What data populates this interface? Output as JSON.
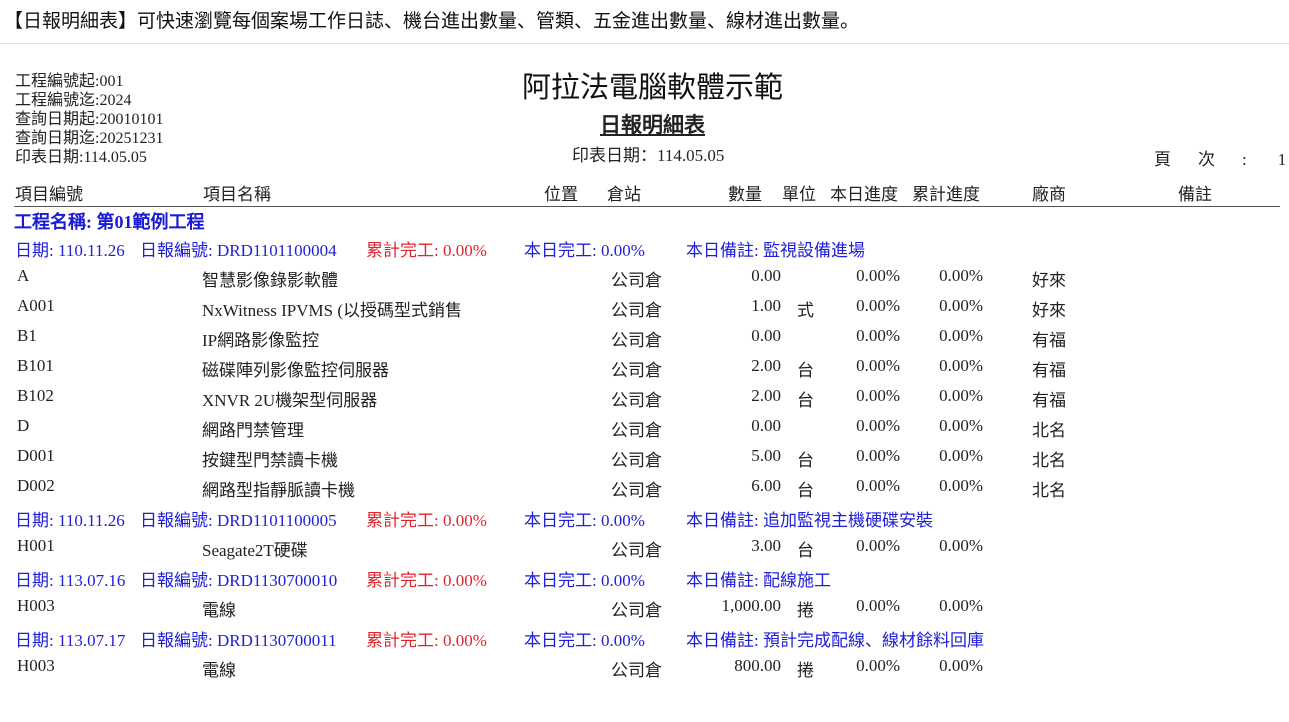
{
  "banner": "【日報明細表】可快速瀏覽每個案場工作日誌、機台進出數量、管類、五金進出數量、線材進出數量。",
  "meta": [
    "工程編號起:001",
    "工程編號迄:2024",
    "查詢日期起:20010101",
    "查詢日期迄:20251231",
    "印表日期:114.05.05"
  ],
  "company": "阿拉法電腦軟體示範",
  "report_title": "日報明細表",
  "print_date": "印表日期：114.05.05",
  "page": {
    "label": "頁次:",
    "number": "1"
  },
  "columns": {
    "code": "項目編號",
    "name": "項目名稱",
    "location": "位置",
    "warehouse": "倉站",
    "qty": "數量",
    "unit": "單位",
    "today": "本日進度",
    "cumulative": "累計進度",
    "vendor": "廠商",
    "note": "備註"
  },
  "project": "工程名稱: 第01範例工程",
  "groups": [
    {
      "date": "日期: 110.11.26",
      "report": "日報編號: DRD1101100004",
      "cum": "累計完工:  0.00%",
      "today": "本日完工:  0.00%",
      "note": "本日備註: 監視設備進場",
      "items": [
        {
          "code": "A",
          "name": "智慧影像錄影軟體",
          "warehouse": "公司倉",
          "qty": "0.00",
          "unit": "",
          "today": "0.00%",
          "cum": "0.00%",
          "vendor": "好來"
        },
        {
          "code": "A001",
          "name": "NxWitness IPVMS (以授碼型式銷售",
          "warehouse": "公司倉",
          "qty": "1.00",
          "unit": "式",
          "today": "0.00%",
          "cum": "0.00%",
          "vendor": "好來"
        },
        {
          "code": "B1",
          "name": "IP網路影像監控",
          "warehouse": "公司倉",
          "qty": "0.00",
          "unit": "",
          "today": "0.00%",
          "cum": "0.00%",
          "vendor": "有福"
        },
        {
          "code": "B101",
          "name": "磁碟陣列影像監控伺服器",
          "warehouse": "公司倉",
          "qty": "2.00",
          "unit": "台",
          "today": "0.00%",
          "cum": "0.00%",
          "vendor": "有福"
        },
        {
          "code": "B102",
          "name": "XNVR 2U機架型伺服器",
          "warehouse": "公司倉",
          "qty": "2.00",
          "unit": "台",
          "today": "0.00%",
          "cum": "0.00%",
          "vendor": "有福"
        },
        {
          "code": "D",
          "name": "網路門禁管理",
          "warehouse": "公司倉",
          "qty": "0.00",
          "unit": "",
          "today": "0.00%",
          "cum": "0.00%",
          "vendor": "北名"
        },
        {
          "code": "D001",
          "name": "按鍵型門禁讀卡機",
          "warehouse": "公司倉",
          "qty": "5.00",
          "unit": "台",
          "today": "0.00%",
          "cum": "0.00%",
          "vendor": "北名"
        },
        {
          "code": "D002",
          "name": "網路型指靜脈讀卡機",
          "warehouse": "公司倉",
          "qty": "6.00",
          "unit": "台",
          "today": "0.00%",
          "cum": "0.00%",
          "vendor": "北名"
        }
      ]
    },
    {
      "date": "日期: 110.11.26",
      "report": "日報編號: DRD1101100005",
      "cum": "累計完工:  0.00%",
      "today": "本日完工:  0.00%",
      "note": "本日備註: 追加監視主機硬碟安裝",
      "items": [
        {
          "code": "H001",
          "name": "Seagate2T硬碟",
          "warehouse": "公司倉",
          "qty": "3.00",
          "unit": "台",
          "today": "0.00%",
          "cum": "0.00%",
          "vendor": ""
        }
      ]
    },
    {
      "date": "日期: 113.07.16",
      "report": "日報編號: DRD1130700010",
      "cum": "累計完工:  0.00%",
      "today": "本日完工:  0.00%",
      "note": "本日備註: 配線施工",
      "items": [
        {
          "code": "H003",
          "name": "電線",
          "warehouse": "公司倉",
          "qty": "1,000.00",
          "unit": "捲",
          "today": "0.00%",
          "cum": "0.00%",
          "vendor": ""
        }
      ]
    },
    {
      "date": "日期: 113.07.17",
      "report": "日報編號: DRD1130700011",
      "cum": "累計完工:  0.00%",
      "today": "本日完工:  0.00%",
      "note": "本日備註: 預計完成配線、線材餘料回庫",
      "items": [
        {
          "code": "H003",
          "name": "電線",
          "warehouse": "公司倉",
          "qty": "800.00",
          "unit": "捲",
          "today": "0.00%",
          "cum": "0.00%",
          "vendor": ""
        }
      ]
    }
  ]
}
